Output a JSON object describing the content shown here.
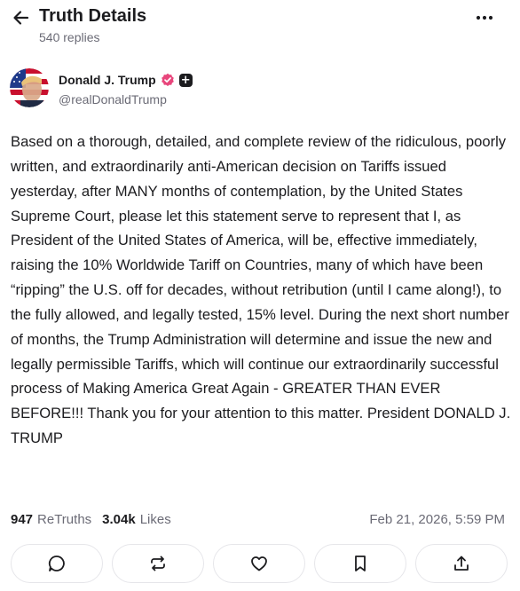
{
  "header": {
    "title": "Truth Details",
    "replies": "540 replies",
    "back_icon": "arrow-left-icon",
    "more_icon": "more-horizontal-icon"
  },
  "author": {
    "name": "Donald J. Trump",
    "handle": "@realDonaldTrump",
    "verified_color": "#e8467c",
    "badge": "+"
  },
  "post": {
    "text": "Based on a thorough, detailed, and complete review of the ridiculous, poorly written, and extraordinarily anti-American decision on Tariffs issued yesterday, after MANY months of contemplation, by the United States Supreme Court, please let this statement serve to represent that I, as President of the United States of America, will be, effective immediately, raising the 10% Worldwide Tariff on Countries, many of which have been “ripping” the U.S. off for decades, without retribution (until I came along!), to the fully allowed, and legally tested, 15% level. During the next short number of months, the Trump Administration will determine and issue the new and legally permissible Tariffs, which will continue our extraordinarily successful process of Making America Great Again - GREATER THAN EVER BEFORE!!! Thank you for your attention to this matter. President DONALD J. TRUMP"
  },
  "stats": {
    "retruths_count": "947",
    "retruths_label": "ReTruths",
    "likes_count": "3.04k",
    "likes_label": "Likes",
    "timestamp": "Feb 21, 2026, 5:59 PM"
  },
  "actions": [
    {
      "name": "reply",
      "icon": "comment-icon"
    },
    {
      "name": "retruth",
      "icon": "retruth-icon"
    },
    {
      "name": "like",
      "icon": "heart-icon"
    },
    {
      "name": "bookmark",
      "icon": "bookmark-icon"
    },
    {
      "name": "share",
      "icon": "share-icon"
    }
  ],
  "colors": {
    "text": "#1c1c1f",
    "muted": "#6b6b76",
    "border": "#e6e6ea",
    "accent": "#e8467c"
  }
}
